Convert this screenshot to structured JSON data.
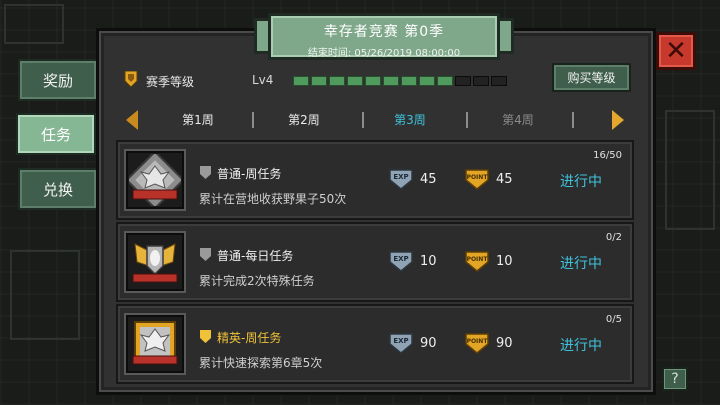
{
  "header": {
    "title": "幸存者竞赛 第0季",
    "subtitle": "结束时间: 05/26/2019 08:00:00"
  },
  "sidebar": {
    "items": [
      {
        "label": "奖励",
        "active": false
      },
      {
        "label": "任务",
        "active": true
      },
      {
        "label": "兑换",
        "active": false
      }
    ]
  },
  "season": {
    "label": "赛季等级",
    "level": "Lv4",
    "progress_segments_total": 12,
    "progress_segments_filled": 9,
    "buy_label": "购买等级"
  },
  "weeks": {
    "tabs": [
      {
        "label": "第1周",
        "state": "normal"
      },
      {
        "label": "第2周",
        "state": "normal"
      },
      {
        "label": "第3周",
        "state": "active"
      },
      {
        "label": "第4周",
        "state": "locked"
      }
    ]
  },
  "tasks": [
    {
      "type": "普通-周任务",
      "elite": false,
      "badge": "silver-eagle-badge-icon",
      "desc": "累计在营地收获野果子50次",
      "exp": "45",
      "point": "45",
      "status": "进行中",
      "progress": "16/50"
    },
    {
      "type": "普通-每日任务",
      "elite": false,
      "badge": "gold-winged-shield-badge-icon",
      "desc": "累计完成2次特殊任务",
      "exp": "10",
      "point": "10",
      "status": "进行中",
      "progress": "0/2"
    },
    {
      "type": "精英-周任务",
      "elite": true,
      "badge": "gold-eagle-badge-icon",
      "desc": "累计快速探索第6章5次",
      "exp": "90",
      "point": "90",
      "status": "进行中",
      "progress": "0/5"
    }
  ],
  "colors": {
    "accent_cyan": "#3ec2dc",
    "panel_green": "#7fa78a",
    "elite_gold": "#f0c23a",
    "close_red": "#c6392c"
  }
}
